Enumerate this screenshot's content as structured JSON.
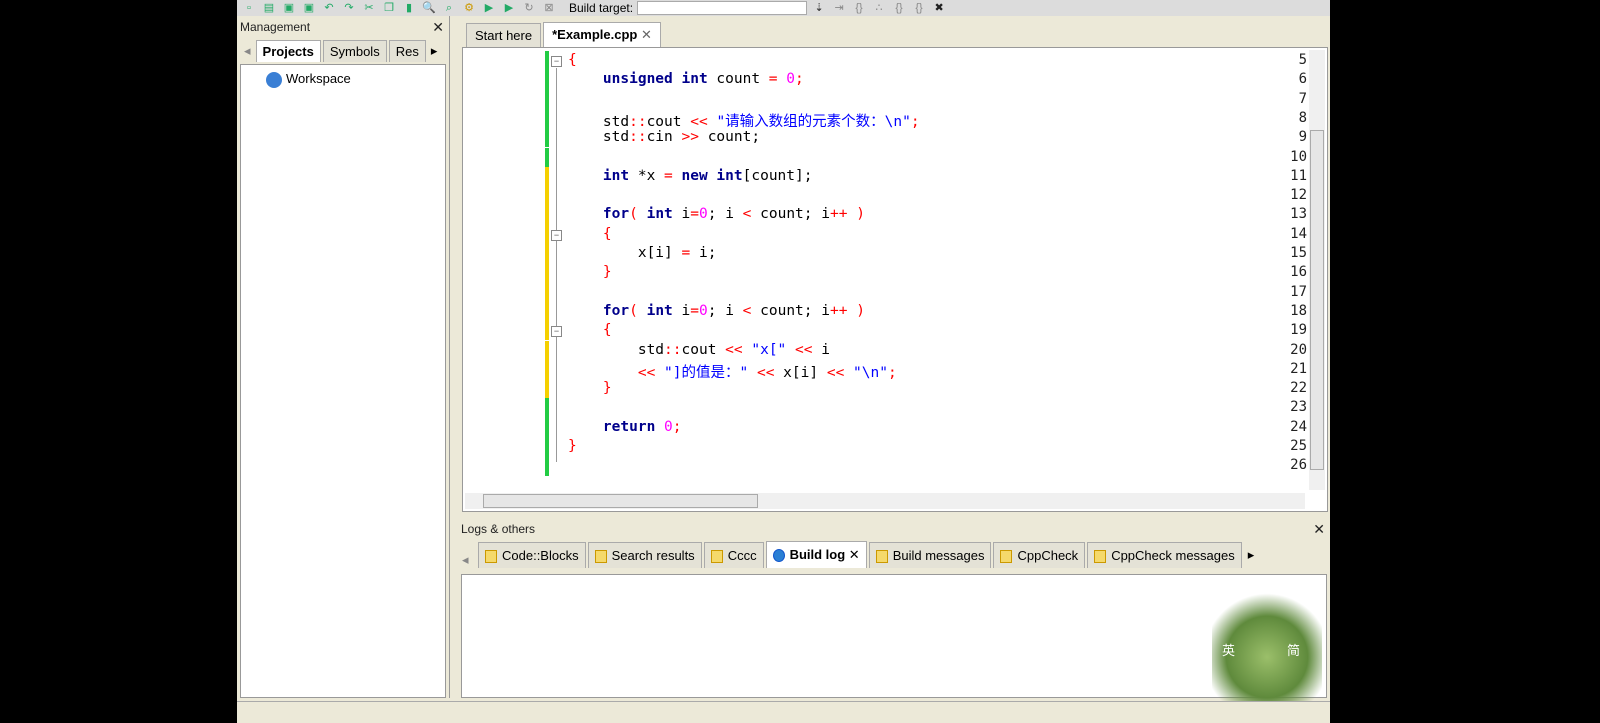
{
  "toolbar": {
    "build_target_label": "Build target:",
    "build_target_value": ""
  },
  "management": {
    "title": "Management",
    "tabs": [
      "Projects",
      "Symbols",
      "Res"
    ],
    "tree": [
      "Workspace"
    ]
  },
  "editor": {
    "tabs": [
      "Start here",
      "*Example.cpp"
    ],
    "lines": [
      {
        "n": "5",
        "t": [
          [
            "op",
            "{"
          ]
        ]
      },
      {
        "n": "6",
        "t": [
          [
            "",
            "    "
          ],
          [
            "kw",
            "unsigned int"
          ],
          [
            "",
            " count "
          ],
          [
            "op",
            "="
          ],
          [
            "",
            " "
          ],
          [
            "num",
            "0"
          ],
          [
            "op",
            ";"
          ]
        ]
      },
      {
        "n": "7",
        "t": []
      },
      {
        "n": "8",
        "t": [
          [
            "",
            "    std"
          ],
          [
            "op",
            "::"
          ],
          [
            "",
            "cout "
          ],
          [
            "op",
            "<<"
          ],
          [
            "",
            " "
          ],
          [
            "str",
            "\"请输入数组的元素个数：\\n\""
          ],
          [
            "op",
            ";"
          ]
        ]
      },
      {
        "n": "9",
        "t": [
          [
            "",
            "    std"
          ],
          [
            "op",
            "::"
          ],
          [
            "",
            "cin "
          ],
          [
            "op",
            ">>"
          ],
          [
            "",
            " count;"
          ]
        ]
      },
      {
        "n": "10",
        "t": []
      },
      {
        "n": "11",
        "t": [
          [
            "",
            "    "
          ],
          [
            "kw",
            "int"
          ],
          [
            "",
            " *x "
          ],
          [
            "op",
            "="
          ],
          [
            "",
            " "
          ],
          [
            "kw",
            "new int"
          ],
          [
            "",
            "[count];"
          ]
        ]
      },
      {
        "n": "12",
        "t": []
      },
      {
        "n": "13",
        "t": [
          [
            "",
            "    "
          ],
          [
            "kw",
            "for"
          ],
          [
            "op",
            "("
          ],
          [
            "",
            " "
          ],
          [
            "kw",
            "int"
          ],
          [
            "",
            " i"
          ],
          [
            "op",
            "="
          ],
          [
            "num",
            "0"
          ],
          [
            "",
            ";"
          ],
          [
            "",
            " i "
          ],
          [
            "op",
            "<"
          ],
          [
            "",
            " count; i"
          ],
          [
            "op",
            "++"
          ],
          [
            "",
            " "
          ],
          [
            "op",
            ")"
          ]
        ]
      },
      {
        "n": "14",
        "t": [
          [
            "",
            "    "
          ],
          [
            "op",
            "{"
          ]
        ]
      },
      {
        "n": "15",
        "t": [
          [
            "",
            "        x[i] "
          ],
          [
            "op",
            "="
          ],
          [
            "",
            " i;"
          ]
        ]
      },
      {
        "n": "16",
        "t": [
          [
            "",
            "    "
          ],
          [
            "op",
            "}"
          ]
        ]
      },
      {
        "n": "17",
        "t": []
      },
      {
        "n": "18",
        "t": [
          [
            "",
            "    "
          ],
          [
            "kw",
            "for"
          ],
          [
            "op",
            "("
          ],
          [
            "",
            " "
          ],
          [
            "kw",
            "int"
          ],
          [
            "",
            " i"
          ],
          [
            "op",
            "="
          ],
          [
            "num",
            "0"
          ],
          [
            "",
            ";"
          ],
          [
            "",
            " i "
          ],
          [
            "op",
            "<"
          ],
          [
            "",
            " count; i"
          ],
          [
            "op",
            "++"
          ],
          [
            "",
            " "
          ],
          [
            "op",
            ")"
          ]
        ]
      },
      {
        "n": "19",
        "t": [
          [
            "",
            "    "
          ],
          [
            "op",
            "{"
          ]
        ]
      },
      {
        "n": "20",
        "t": [
          [
            "",
            "        std"
          ],
          [
            "op",
            "::"
          ],
          [
            "",
            "cout "
          ],
          [
            "op",
            "<<"
          ],
          [
            "",
            " "
          ],
          [
            "str",
            "\"x[\""
          ],
          [
            "",
            " "
          ],
          [
            "op",
            "<<"
          ],
          [
            "",
            " i"
          ]
        ]
      },
      {
        "n": "21",
        "t": [
          [
            "",
            "        "
          ],
          [
            "op",
            "<<"
          ],
          [
            "",
            " "
          ],
          [
            "str",
            "\"]的值是：\""
          ],
          [
            "",
            " "
          ],
          [
            "op",
            "<<"
          ],
          [
            "",
            " x[i] "
          ],
          [
            "op",
            "<<"
          ],
          [
            "",
            " "
          ],
          [
            "str",
            "\"\\n\""
          ],
          [
            "op",
            ";"
          ]
        ]
      },
      {
        "n": "22",
        "t": [
          [
            "",
            "    "
          ],
          [
            "op",
            "}"
          ]
        ]
      },
      {
        "n": "23",
        "t": []
      },
      {
        "n": "24",
        "t": [
          [
            "",
            "    "
          ],
          [
            "kw",
            "return"
          ],
          [
            "",
            " "
          ],
          [
            "num",
            "0"
          ],
          [
            "op",
            ";"
          ]
        ]
      },
      {
        "n": "25",
        "t": [
          [
            "op",
            "}"
          ]
        ]
      },
      {
        "n": "26",
        "t": []
      }
    ],
    "change_colors": {
      "saved": "#22cc44",
      "modified": "#f5d000"
    }
  },
  "logs": {
    "title": "Logs & others",
    "tabs": [
      "Code::Blocks",
      "Search results",
      "Cccc",
      "Build log",
      "Build messages",
      "CppCheck",
      "CppCheck messages"
    ],
    "active": "Build log"
  },
  "ime": {
    "left": "英",
    "right": "简"
  }
}
